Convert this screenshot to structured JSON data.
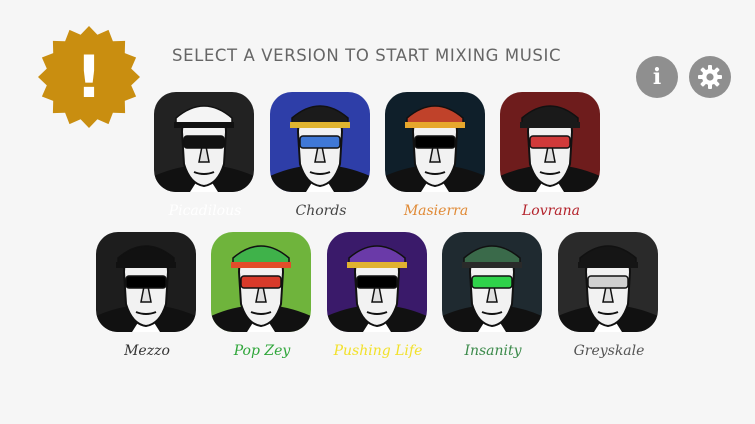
{
  "header": {
    "title": "SELECT A VERSION TO START MIXING MUSIC"
  },
  "alert_badge": {
    "glyph": "!",
    "color": "#c98e10",
    "icon": "exclamation-icon"
  },
  "buttons": {
    "info": {
      "glyph": "i",
      "icon": "info-icon"
    },
    "settings": {
      "icon": "gear-icon"
    }
  },
  "versions": [
    {
      "label": "Picadilous",
      "color": "#ffffff",
      "bg": "#222222",
      "hat": "#f4f4f4",
      "hat_band": "#111111",
      "glasses": "#111111"
    },
    {
      "label": "Chords",
      "color": "#444444",
      "bg": "#2e3ea8",
      "hat": "#1b1b1b",
      "hat_band": "#e0b430",
      "glasses": "#3f78d6"
    },
    {
      "label": "Masierra",
      "color": "#e08a36",
      "bg": "#0f1f2a",
      "hat": "#c0422a",
      "hat_band": "#e7a72c",
      "glasses": "#000000"
    },
    {
      "label": "Lovrana",
      "color": "#b4232c",
      "bg": "#6e1c1c",
      "hat": "#1a1a1a",
      "hat_band": "#1a1a1a",
      "glasses": "#d03a3a"
    },
    {
      "label": "Mezzo",
      "color": "#333333",
      "bg": "#1d1d1d",
      "hat": "#111111",
      "hat_band": "#111111",
      "glasses": "#000000"
    },
    {
      "label": "Pop Zey",
      "color": "#2fa63a",
      "bg": "#6fb43c",
      "hat": "#3fb24a",
      "hat_band": "#e24c2a",
      "glasses": "#d83a2a"
    },
    {
      "label": "Pushing Life",
      "color": "#f2e12a",
      "bg": "#3a1a6a",
      "hat": "#6a3aa8",
      "hat_band": "#e0b230",
      "glasses": "#000000"
    },
    {
      "label": "Insanity",
      "color": "#3b8a4a",
      "bg": "#1f2a30",
      "hat": "#3a6a4a",
      "hat_band": "#2a2a2a",
      "glasses": "#2fd24a"
    },
    {
      "label": "Greyskale",
      "color": "#555555",
      "bg": "#2a2a2a",
      "hat": "#151515",
      "hat_band": "#151515",
      "glasses": "#d0d0d0"
    }
  ]
}
